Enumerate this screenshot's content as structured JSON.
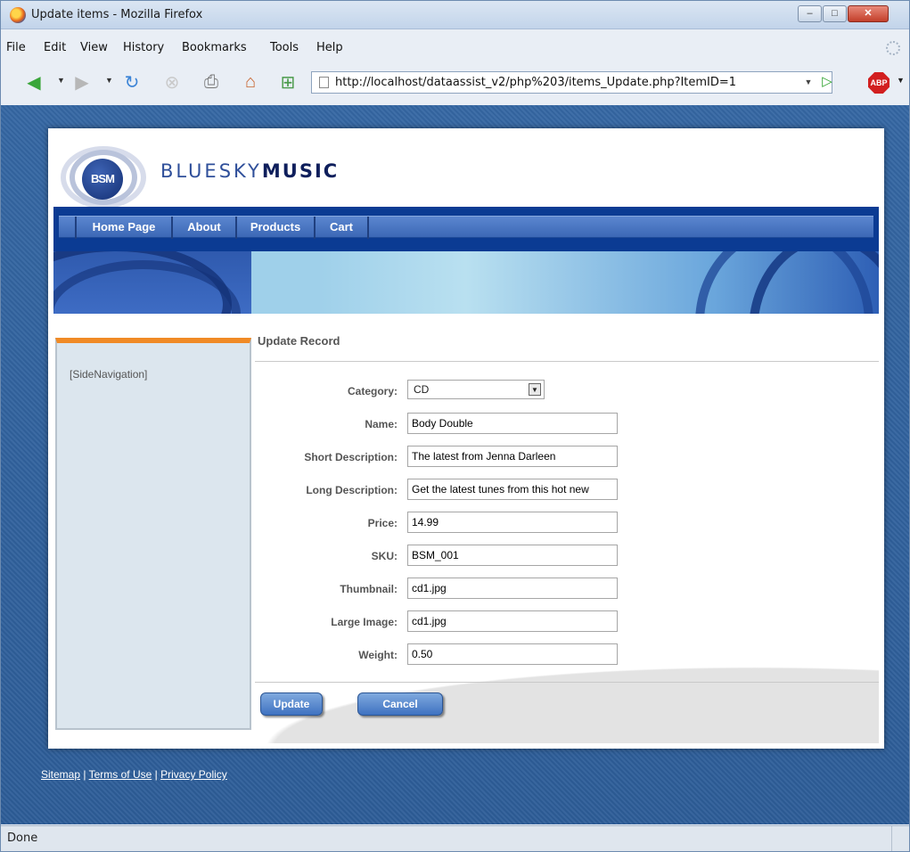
{
  "window": {
    "title": "Update items - Mozilla Firefox",
    "minimize_glyph": "–",
    "maximize_glyph": "□",
    "close_glyph": "✕"
  },
  "menubar": [
    "File",
    "Edit",
    "View",
    "History",
    "Bookmarks",
    "Tools",
    "Help"
  ],
  "toolbar": {
    "url": "http://localhost/dataassist_v2/php%203/items_Update.php?ItemID=1",
    "abp_label": "ABP"
  },
  "site": {
    "logo_mark": "BSM",
    "brand_light": "BLUESKY",
    "brand_bold": "MUSIC",
    "nav": [
      "Home Page",
      "About",
      "Products",
      "Cart"
    ],
    "side_navigation": "[SideNavigation]"
  },
  "form": {
    "title": "Update Record",
    "category": {
      "label": "Category:",
      "value": "CD"
    },
    "fields": [
      {
        "label": "Name:",
        "value": "Body Double"
      },
      {
        "label": "Short Description:",
        "value": "The latest from Jenna Darleen"
      },
      {
        "label": "Long Description:",
        "value": "Get the latest tunes from this hot new"
      },
      {
        "label": "Price:",
        "value": "14.99"
      },
      {
        "label": "SKU:",
        "value": "BSM_001"
      },
      {
        "label": "Thumbnail:",
        "value": "cd1.jpg"
      },
      {
        "label": "Large Image:",
        "value": "cd1.jpg"
      },
      {
        "label": "Weight:",
        "value": "0.50"
      }
    ],
    "update_label": "Update",
    "cancel_label": "Cancel"
  },
  "footer": {
    "sitemap": "Sitemap",
    "terms": "Terms of Use",
    "privacy": "Privacy Policy",
    "sep": "|"
  },
  "status": "Done",
  "colors": {
    "accent_orange": "#f08a26",
    "nav_blue": "#0b3b93",
    "page_blue": "#2d5d98"
  }
}
